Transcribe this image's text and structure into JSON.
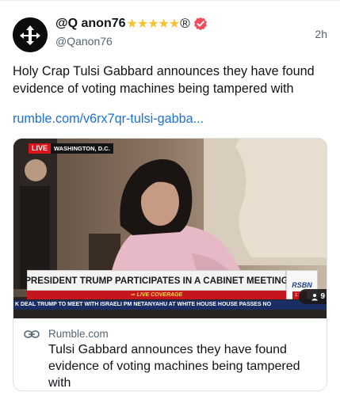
{
  "user": {
    "display_name": "@Q anon76",
    "stars": "★★★★★",
    "registered_mark": "®",
    "handle": "@Qanon76",
    "verified_icon": "verified-badge-icon",
    "verified_color": "#f24b5a"
  },
  "post": {
    "timestamp": "2h",
    "text": "Holy Crap Tulsi Gabbard announces they have found evidence of voting machines being tampered with",
    "link_text": "rumble.com/v6rx7qr-tulsi-gabba..."
  },
  "card": {
    "thumbnail": {
      "live_label": "LIVE",
      "location": "WASHINGTON, D.C.",
      "banner": "PRESIDENT TRUMP PARTICIPATES IN A CABINET MEETING",
      "live_coverage": "⇒ LIVE COVERAGE",
      "network": "RSBN",
      "ticker": "K DEAL    TRUMP TO MEET WITH ISRAELI PM NETANYAHU AT WHITE HOUSE    HOUSE PASSES NO",
      "ticker_time": "1:22",
      "viewer_count": "9"
    },
    "domain": "Rumble.com",
    "title": "Tulsi Gabbard announces they have found evidence of voting machines being tampered with",
    "link_icon": "link-icon"
  },
  "colors": {
    "link": "#1d6fd8",
    "secondary_text": "#536471",
    "star": "#f4c430",
    "live_red": "#d8141c"
  }
}
